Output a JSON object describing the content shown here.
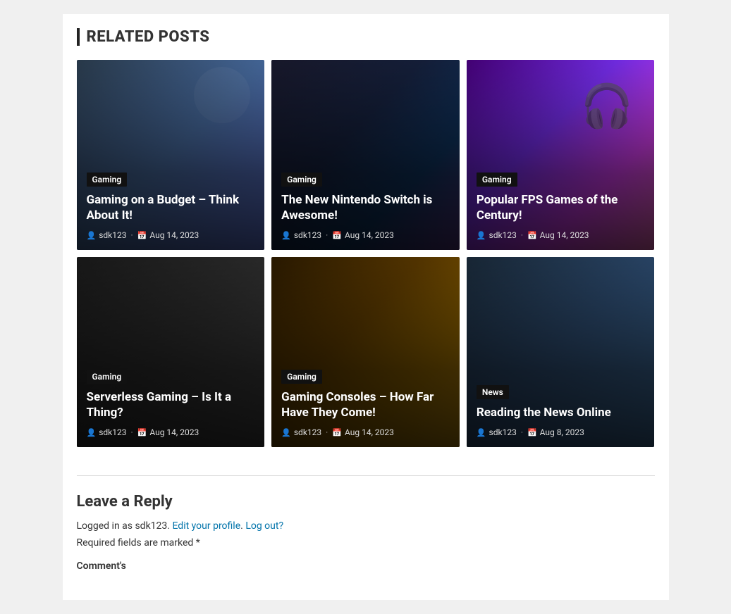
{
  "section": {
    "title": "RELATED POSTS"
  },
  "posts": [
    {
      "id": "post-1",
      "category": "Gaming",
      "title": "Gaming on a Budget – Think About It!",
      "author": "sdk123",
      "date": "Aug 14, 2023",
      "bgClass": "card-bg-1"
    },
    {
      "id": "post-2",
      "category": "Gaming",
      "title": "The New Nintendo Switch is Awesome!",
      "author": "sdk123",
      "date": "Aug 14, 2023",
      "bgClass": "card-bg-2"
    },
    {
      "id": "post-3",
      "category": "Gaming",
      "title": "Popular FPS Games of the Century!",
      "author": "sdk123",
      "date": "Aug 14, 2023",
      "bgClass": "card-bg-3"
    },
    {
      "id": "post-4",
      "category": "Gaming",
      "title": "Serverless Gaming – Is It a Thing?",
      "author": "sdk123",
      "date": "Aug 14, 2023",
      "bgClass": "card-bg-4"
    },
    {
      "id": "post-5",
      "category": "Gaming",
      "title": "Gaming Consoles – How Far Have They Come!",
      "author": "sdk123",
      "date": "Aug 14, 2023",
      "bgClass": "card-bg-5"
    },
    {
      "id": "post-6",
      "category": "News",
      "title": "Reading the News Online",
      "author": "sdk123",
      "date": "Aug 8, 2023",
      "bgClass": "card-bg-6"
    }
  ],
  "reply_section": {
    "title": "Leave a Reply",
    "logged_in_text": "Logged in as sdk123.",
    "edit_profile_link": "Edit your profile",
    "logout_link": "Log out?",
    "required_fields_text": "Required fields are marked",
    "required_marker": "*",
    "comment_label": "Comment's"
  }
}
